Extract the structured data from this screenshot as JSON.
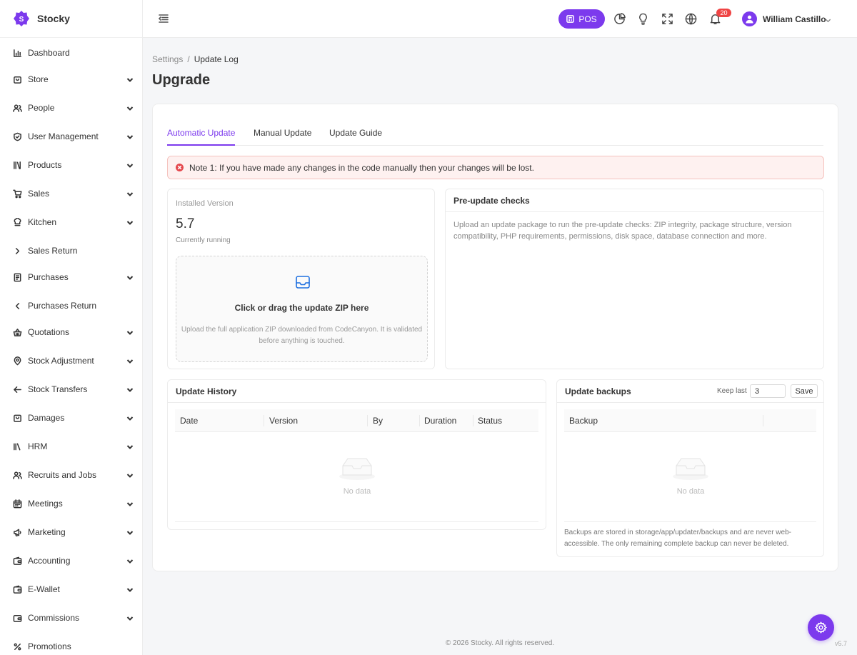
{
  "brand": {
    "name": "Stocky",
    "logo_letter": "S"
  },
  "sidebar": {
    "items": [
      {
        "label": "Dashboard",
        "icon": "bar-chart-icon",
        "caret": "none"
      },
      {
        "label": "Store",
        "icon": "store-bag-icon",
        "caret": "down"
      },
      {
        "label": "People",
        "icon": "users-icon",
        "caret": "down"
      },
      {
        "label": "User Management",
        "icon": "shield-check-icon",
        "caret": "down"
      },
      {
        "label": "Products",
        "icon": "books-icon",
        "caret": "down"
      },
      {
        "label": "Sales",
        "icon": "cart-icon",
        "caret": "down"
      },
      {
        "label": "Kitchen",
        "icon": "chef-hat-icon",
        "caret": "down"
      },
      {
        "label": "Sales Return",
        "icon": "chevron-right-icon",
        "caret": "none"
      },
      {
        "label": "Purchases",
        "icon": "receipt-icon",
        "caret": "down"
      },
      {
        "label": "Purchases Return",
        "icon": "chevron-left-icon",
        "caret": "none"
      },
      {
        "label": "Quotations",
        "icon": "basket-icon",
        "caret": "down"
      },
      {
        "label": "Stock Adjustment",
        "icon": "map-pin-icon",
        "caret": "down"
      },
      {
        "label": "Stock Transfers",
        "icon": "arrow-left-icon",
        "caret": "down"
      },
      {
        "label": "Damages",
        "icon": "box-icon",
        "caret": "down"
      },
      {
        "label": "HRM",
        "icon": "library-icon",
        "caret": "down"
      },
      {
        "label": "Recruits and Jobs",
        "icon": "user-group-icon",
        "caret": "down"
      },
      {
        "label": "Meetings",
        "icon": "calendar-icon",
        "caret": "down"
      },
      {
        "label": "Marketing",
        "icon": "megaphone-icon",
        "caret": "down"
      },
      {
        "label": "Accounting",
        "icon": "wallet-icon",
        "caret": "down"
      },
      {
        "label": "E-Wallet",
        "icon": "e-wallet-icon",
        "caret": "down"
      },
      {
        "label": "Commissions",
        "icon": "commission-icon",
        "caret": "down"
      },
      {
        "label": "Promotions",
        "icon": "percent-icon",
        "caret": "none"
      }
    ]
  },
  "header": {
    "pos_label": "POS",
    "notifications_count": "20",
    "user_name": "William Castillo"
  },
  "breadcrumb": {
    "parent": "Settings",
    "separator": "/",
    "current": "Update Log"
  },
  "page_title": "Upgrade",
  "tabs": [
    {
      "label": "Automatic Update",
      "active": true
    },
    {
      "label": "Manual Update",
      "active": false
    },
    {
      "label": "Update Guide",
      "active": false
    }
  ],
  "alert": {
    "text": "Note 1: If you have made any changes in the code manually then your changes will be lost."
  },
  "installed": {
    "label": "Installed Version",
    "version": "5.7",
    "status": "Currently running",
    "dropzone_title": "Click or drag the update ZIP here",
    "dropzone_desc": "Upload the full application ZIP downloaded from CodeCanyon. It is validated before anything is touched."
  },
  "prechecks": {
    "title": "Pre-update checks",
    "text": "Upload an update package to run the pre-update checks: ZIP integrity, package structure, version compatibility, PHP requirements, permissions, disk space, database connection and more."
  },
  "history": {
    "title": "Update History",
    "columns": [
      "Date",
      "Version",
      "By",
      "Duration",
      "Status"
    ],
    "empty_text": "No data"
  },
  "backups": {
    "title": "Update backups",
    "keep_label": "Keep last",
    "keep_value": "3",
    "save_label": "Save",
    "columns": [
      "Backup"
    ],
    "empty_text": "No data",
    "note": "Backups are stored in storage/app/updater/backups and are never web-accessible. The only remaining complete backup can never be deleted."
  },
  "footer": {
    "copyright": "© 2026 Stocky. All rights reserved.",
    "version": "v5.7"
  },
  "colors": {
    "accent": "#7c3aed",
    "alert_bg": "#fef1f0",
    "alert_icon": "#e5484d",
    "badge": "#ef4444",
    "upload_icon": "#1d6fe0"
  }
}
